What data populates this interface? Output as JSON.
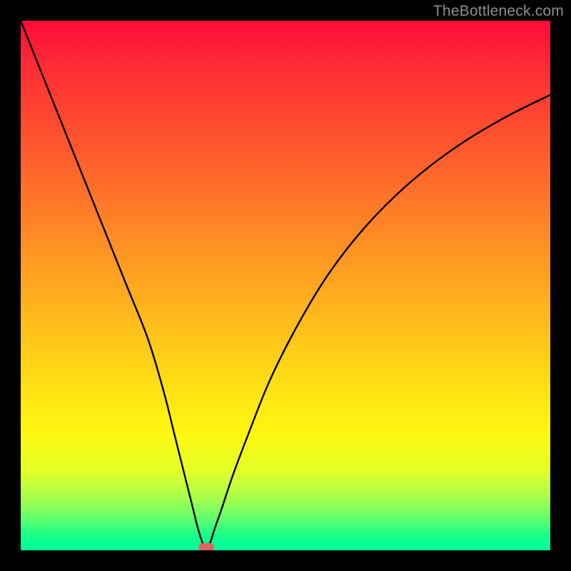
{
  "watermark": "TheBottleneck.com",
  "chart_data": {
    "type": "line",
    "title": "",
    "xlabel": "",
    "ylabel": "",
    "xlim": [
      0,
      100
    ],
    "ylim": [
      0,
      100
    ],
    "grid": false,
    "legend": false,
    "background_gradient": {
      "top_color": "#ff0a3a",
      "bottom_color": "#00ff9c",
      "meaning": "red=high bottleneck, green=low bottleneck"
    },
    "series": [
      {
        "name": "bottleneck-curve",
        "color": "#000000",
        "x": [
          0,
          4,
          8,
          12,
          16,
          20,
          24,
          27,
          29,
          31,
          32.5,
          33.5,
          34.3,
          34.8,
          35.2,
          35.8,
          36.6,
          38,
          40,
          43,
          47,
          52,
          58,
          65,
          73,
          82,
          91,
          100
        ],
        "values": [
          100,
          90,
          80,
          70,
          60,
          50,
          40,
          30,
          22,
          14,
          8,
          4,
          1.5,
          0.5,
          0.5,
          1.5,
          4,
          8,
          14,
          22,
          32,
          42,
          52,
          61,
          69,
          76,
          81.5,
          86
        ]
      }
    ],
    "markers": [
      {
        "name": "optimal-point",
        "x": 35,
        "y": 0.5,
        "color": "#e0645f",
        "shape": "rounded-rect"
      }
    ]
  },
  "frame": {
    "outer_size_px": 800,
    "border_px": 29,
    "border_color": "#000000"
  }
}
